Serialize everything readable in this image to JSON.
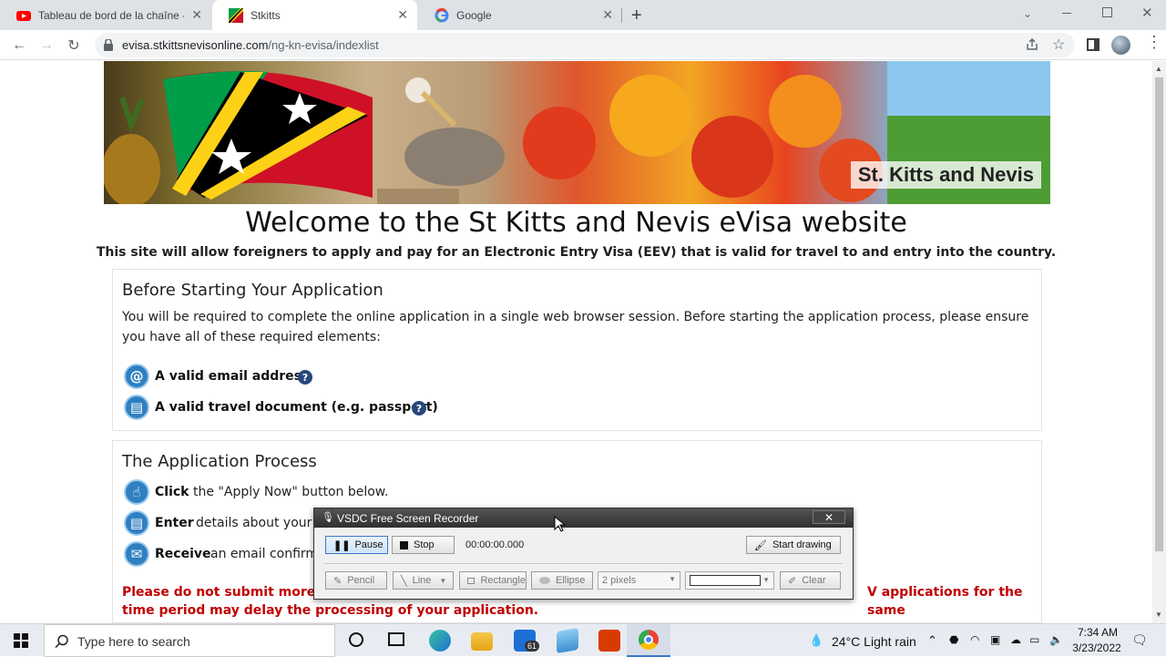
{
  "browser": {
    "tabs": [
      {
        "label": "Tableau de bord de la chaîne - Yo",
        "icon": "youtube-icon",
        "active": false
      },
      {
        "label": "Stkitts",
        "icon": "flag-icon",
        "active": true
      },
      {
        "label": "Google",
        "icon": "google-icon",
        "active": false
      }
    ],
    "url_host": "evisa.stkittsnevisonline.com",
    "url_path": "/ng-kn-evisa/indexlist"
  },
  "page": {
    "banner_title": "St. Kitts and Nevis",
    "heading": "Welcome to the St Kitts and Nevis eVisa website",
    "intro": "This site will allow foreigners to apply and pay for an Electronic Entry Visa (EEV) that is valid for travel to and entry into the country.",
    "before": {
      "title": "Before Starting Your Application",
      "text": "You will be required to complete the online application in a single web browser session. Before starting the application process, please ensure you have all of these required elements:",
      "requirements": [
        {
          "label": "A valid email address",
          "icon": "at-icon"
        },
        {
          "label": "A valid travel document (e.g. passport)",
          "icon": "passport-icon"
        }
      ]
    },
    "process": {
      "title": "The Application Process",
      "steps": [
        {
          "label": "Click",
          "desc": "the \"Apply Now\" button below."
        },
        {
          "label": "Enter",
          "desc": "details about your v"
        },
        {
          "label": "Receive",
          "desc": "an email confirmi"
        }
      ],
      "warning_start": "Please do not submit more tha",
      "warning_end": "V applications for the same",
      "warning_line2": "time period may delay the processing of your application."
    }
  },
  "recorder": {
    "title": "VSDC Free Screen Recorder",
    "close": "✕",
    "pause": "Pause",
    "stop": "Stop",
    "time": "00:00:00.000",
    "start_drawing": "Start drawing",
    "pencil": "Pencil",
    "line": "Line",
    "rectangle": "Rectangle",
    "ellipse": "Ellipse",
    "pixels": "2 pixels",
    "clear": "Clear"
  },
  "taskbar": {
    "search_placeholder": "Type here to search",
    "mail_badge": "61",
    "weather": "24°C  Light rain",
    "time": "7:34 AM",
    "date": "3/23/2022"
  },
  "colors": {
    "warning": "#c00000",
    "accent_icon": "#2f7fc1",
    "help": "#27477a"
  }
}
